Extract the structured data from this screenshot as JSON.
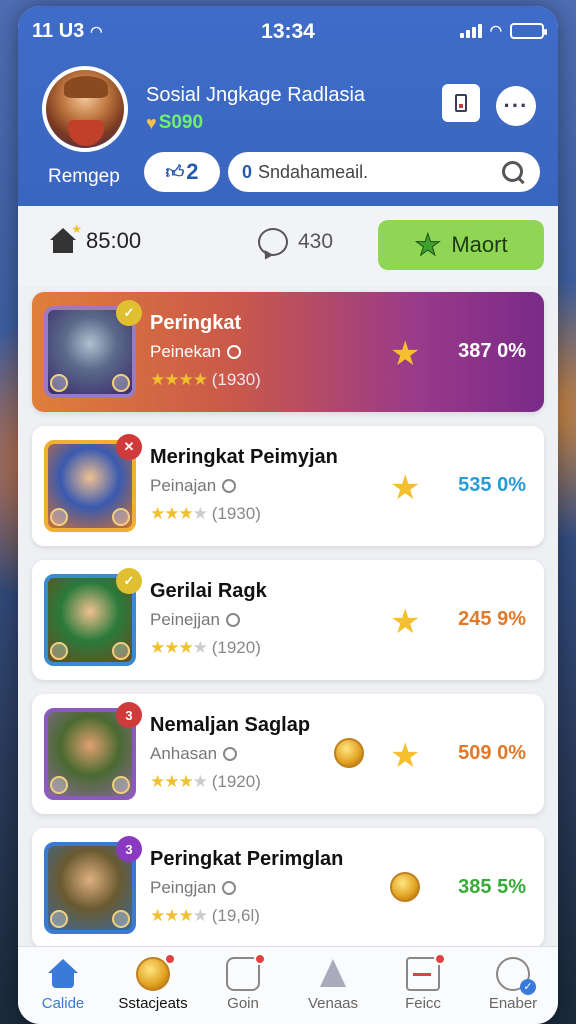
{
  "status_bar": {
    "left": "11 U3",
    "time": "13:34"
  },
  "profile": {
    "app_title": "Sosial Jngkage Radlasia",
    "coins": "S090",
    "username": "Remgep",
    "level_badge": "2"
  },
  "search": {
    "prefix": "0",
    "value": "Sndahameail."
  },
  "stats": {
    "homes": "85:00",
    "messages": "430",
    "mark_label": "Maort"
  },
  "cards": [
    {
      "title": "Peringkat",
      "subtitle": "Peinekan",
      "rating": "(1930)",
      "percent": "387 0%",
      "color": "#ffffff",
      "badge": "✓",
      "badge_color": "#e0c030",
      "stars": 4
    },
    {
      "title": "Meringkat Peimyjan",
      "subtitle": "Peinajan",
      "rating": "(1930)",
      "percent": "535 0%",
      "color": "#2a9ad8",
      "badge": "✕",
      "badge_color": "#d03a3a",
      "stars": 3
    },
    {
      "title": "Gerilai Ragk",
      "subtitle": "Peinejjan",
      "rating": "(1920)",
      "percent": "245 9%",
      "color": "#e07a2a",
      "badge": "✓",
      "badge_color": "#e0c030",
      "stars": 3
    },
    {
      "title": "Nemaljan Saglap",
      "subtitle": "Anhasan",
      "rating": "(1920)",
      "percent": "509 0%",
      "color": "#e07a2a",
      "badge": "3",
      "badge_color": "#d03a3a",
      "stars": 3
    },
    {
      "title": "Peringkat Perimglan",
      "subtitle": "Peingjan",
      "rating": "(19,6l)",
      "percent": "385 5%",
      "color": "#3aaa3a",
      "badge": "3",
      "badge_color": "#8a3ac0",
      "stars": 3
    }
  ],
  "tabs": [
    {
      "label": "Calide",
      "icon": "home-icon"
    },
    {
      "label": "Sstacjeats",
      "icon": "coin-icon"
    },
    {
      "label": "Goin",
      "icon": "glove-icon"
    },
    {
      "label": "Venaas",
      "icon": "gem-icon"
    },
    {
      "label": "Feicc",
      "icon": "document-icon"
    },
    {
      "label": "Enaber",
      "icon": "user-icon"
    }
  ],
  "colors": {
    "header": "#3f6cc8",
    "accent_green": "#8fd654",
    "coin_green": "#6ef06a"
  }
}
